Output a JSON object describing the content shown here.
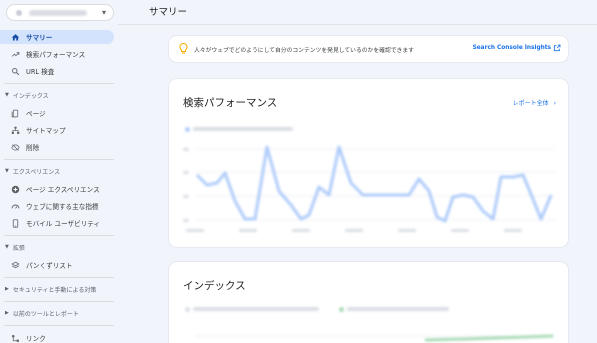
{
  "sidebar": {
    "property": "https://www.abcde...",
    "items": [
      {
        "label": "サマリー",
        "icon": "home-icon"
      },
      {
        "label": "検索パフォーマンス",
        "icon": "trending-up-icon"
      },
      {
        "label": "URL 検査",
        "icon": "search-icon"
      }
    ],
    "sections": [
      {
        "label": "インデックス",
        "items": [
          {
            "label": "ページ",
            "icon": "page-icon"
          },
          {
            "label": "サイトマップ",
            "icon": "sitemap-icon"
          },
          {
            "label": "削除",
            "icon": "removal-icon"
          }
        ]
      },
      {
        "label": "エクスペリエンス",
        "items": [
          {
            "label": "ページ エクスペリエンス",
            "icon": "plus-circle-icon"
          },
          {
            "label": "ウェブに関する主な指標",
            "icon": "gauge-icon"
          },
          {
            "label": "モバイル ユーザビリティ",
            "icon": "phone-icon"
          }
        ]
      },
      {
        "label": "拡張",
        "items": [
          {
            "label": "パンくずリスト",
            "icon": "layers-icon"
          }
        ]
      },
      {
        "label": "セキュリティと手動による対策",
        "items": []
      },
      {
        "label": "以前のツールとレポート",
        "items": []
      }
    ],
    "bottom_item": {
      "label": "リンク",
      "icon": "links-icon"
    }
  },
  "header": {
    "title": "サマリー"
  },
  "banner": {
    "text": "人々がウェブでどのようにして自分のコンテンツを発見しているのかを確認できます",
    "link": "Search Console Insights"
  },
  "performance": {
    "title": "検索パフォーマンス",
    "report_link": "レポート全体"
  },
  "index": {
    "title": "インデックス"
  },
  "colors": {
    "accent": "#1a73e8",
    "active_bg": "#d3e3fd",
    "chart_line": "#aecbfa",
    "index_green": "#a8dab5"
  }
}
